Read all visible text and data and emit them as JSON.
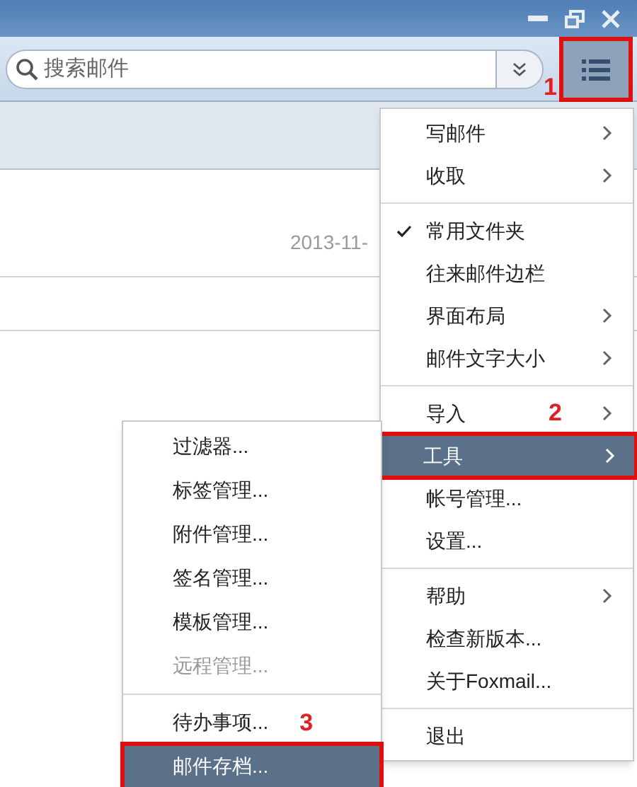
{
  "search": {
    "placeholder": "搜索邮件"
  },
  "menu_button": {
    "selected": true,
    "annotation": "1"
  },
  "list": {
    "date": "2013-11-"
  },
  "main_menu": [
    {
      "kind": "item",
      "label": "写邮件",
      "submenu": true,
      "checked": false,
      "selected": false
    },
    {
      "kind": "item",
      "label": "收取",
      "submenu": true,
      "checked": false,
      "selected": false
    },
    {
      "kind": "separator"
    },
    {
      "kind": "item",
      "label": "常用文件夹",
      "submenu": false,
      "checked": true,
      "selected": false
    },
    {
      "kind": "item",
      "label": "往来邮件边栏",
      "submenu": false,
      "checked": false,
      "selected": false
    },
    {
      "kind": "item",
      "label": "界面布局",
      "submenu": true,
      "checked": false,
      "selected": false
    },
    {
      "kind": "item",
      "label": "邮件文字大小",
      "submenu": true,
      "checked": false,
      "selected": false
    },
    {
      "kind": "separator"
    },
    {
      "kind": "item",
      "label": "导入",
      "submenu": true,
      "checked": false,
      "selected": false,
      "annotation": "2"
    },
    {
      "kind": "item",
      "label": "工具",
      "submenu": true,
      "checked": false,
      "selected": true
    },
    {
      "kind": "item",
      "label": "帐号管理...",
      "submenu": false,
      "checked": false,
      "selected": false
    },
    {
      "kind": "item",
      "label": "设置...",
      "submenu": false,
      "checked": false,
      "selected": false
    },
    {
      "kind": "separator"
    },
    {
      "kind": "item",
      "label": "帮助",
      "submenu": true,
      "checked": false,
      "selected": false
    },
    {
      "kind": "item",
      "label": "检查新版本...",
      "submenu": false,
      "checked": false,
      "selected": false
    },
    {
      "kind": "item",
      "label": "关于Foxmail...",
      "submenu": false,
      "checked": false,
      "selected": false
    },
    {
      "kind": "separator"
    },
    {
      "kind": "item",
      "label": "退出",
      "submenu": false,
      "checked": false,
      "selected": false
    }
  ],
  "tools_menu": [
    {
      "kind": "item",
      "label": "过滤器...",
      "disabled": false,
      "selected": false
    },
    {
      "kind": "item",
      "label": "标签管理...",
      "disabled": false,
      "selected": false
    },
    {
      "kind": "item",
      "label": "附件管理...",
      "disabled": false,
      "selected": false
    },
    {
      "kind": "item",
      "label": "签名管理...",
      "disabled": false,
      "selected": false
    },
    {
      "kind": "item",
      "label": "模板管理...",
      "disabled": false,
      "selected": false
    },
    {
      "kind": "item",
      "label": "远程管理...",
      "disabled": true,
      "selected": false
    },
    {
      "kind": "separator"
    },
    {
      "kind": "item",
      "label": "待办事项...",
      "disabled": false,
      "selected": false,
      "annotation": "3"
    },
    {
      "kind": "item",
      "label": "邮件存档...",
      "disabled": false,
      "selected": true
    }
  ]
}
